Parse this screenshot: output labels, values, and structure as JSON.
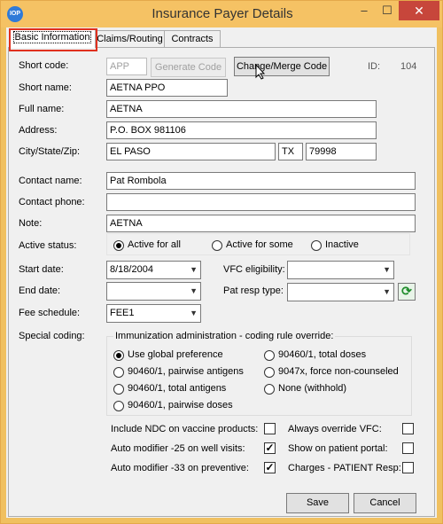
{
  "window": {
    "title": "Insurance Payer Details",
    "minimize": "–",
    "maximize": "☐",
    "close": "✕",
    "app_icon_text": "IOP"
  },
  "tabs": [
    {
      "label": "Basic Information"
    },
    {
      "label": "Claims/Routing"
    },
    {
      "label": "Contracts"
    }
  ],
  "fields": {
    "short_code": {
      "label": "Short code:",
      "value": "APP",
      "generate_label": "Generate Code",
      "change_label": "Change/Merge Code",
      "id_label": "ID:",
      "id_value": "104"
    },
    "short_name": {
      "label": "Short name:",
      "value": "AETNA PPO"
    },
    "full_name": {
      "label": "Full name:",
      "value": "AETNA"
    },
    "address": {
      "label": "Address:",
      "value": "P.O. BOX 981106"
    },
    "city_state_zip": {
      "label": "City/State/Zip:",
      "city": "EL PASO",
      "state": "TX",
      "zip": "79998"
    },
    "contact_name": {
      "label": "Contact name:",
      "value": "Pat Rombola"
    },
    "contact_phone": {
      "label": "Contact phone:",
      "value": ""
    },
    "note": {
      "label": "Note:",
      "value": "AETNA"
    },
    "active_status": {
      "label": "Active status:",
      "options": [
        "Active for all",
        "Active for some",
        "Inactive"
      ],
      "selected": "Active for all"
    },
    "start_date": {
      "label": "Start date:",
      "value": "8/18/2004"
    },
    "end_date": {
      "label": "End date:",
      "value": ""
    },
    "fee_schedule": {
      "label": "Fee schedule:",
      "value": "FEE1"
    },
    "vfc_eligibility": {
      "label": "VFC eligibility:",
      "value": ""
    },
    "pat_resp_type": {
      "label": "Pat resp type:",
      "value": ""
    },
    "special_coding": {
      "label": "Special coding:"
    }
  },
  "immunization": {
    "title": "Immunization administration - coding rule override:",
    "options": [
      "Use global preference",
      "90460/1, pairwise antigens",
      "90460/1, total antigens",
      "90460/1, pairwise doses",
      "90460/1, total doses",
      "9047x, force non-counseled",
      "None (withhold)"
    ],
    "selected": "Use global preference"
  },
  "checkboxes": [
    {
      "label": "Include NDC on vaccine products:",
      "checked": false
    },
    {
      "label": "Auto modifier -25 on well visits:",
      "checked": true
    },
    {
      "label": "Auto modifier -33 on preventive:",
      "checked": true
    },
    {
      "label": "Always override VFC:",
      "checked": false
    },
    {
      "label": "Show on patient portal:",
      "checked": false
    },
    {
      "label": "Charges - PATIENT Resp:",
      "checked": false
    }
  ],
  "buttons": {
    "save": "Save",
    "cancel": "Cancel"
  }
}
